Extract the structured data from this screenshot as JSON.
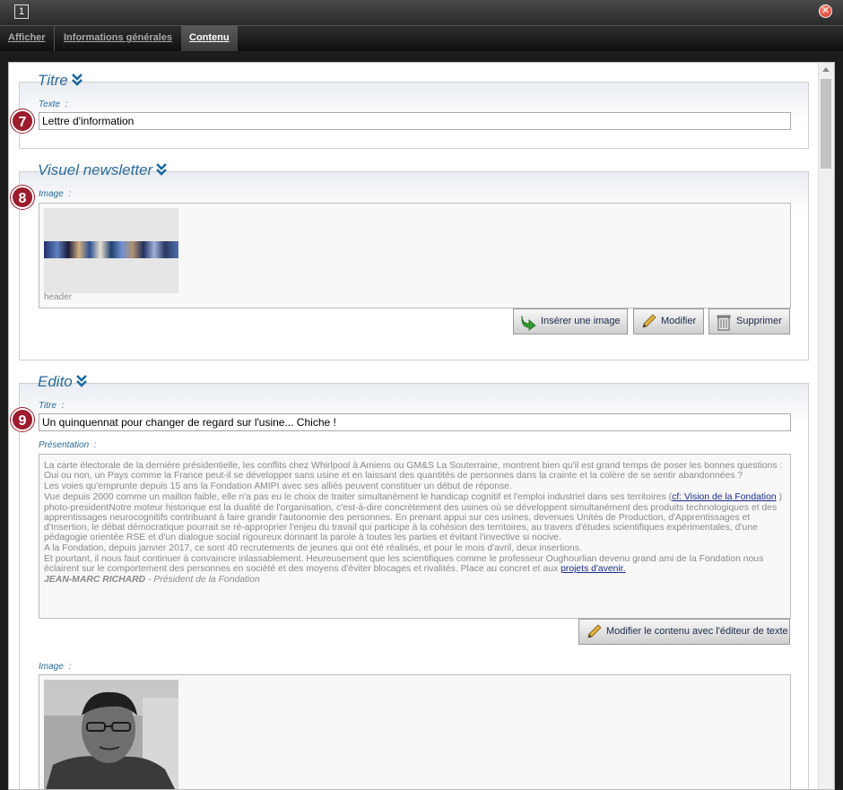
{
  "window": {
    "number": "1",
    "close_glyph": "✕"
  },
  "tabs": [
    {
      "label": "Afficher"
    },
    {
      "label": "Informations générales"
    },
    {
      "label": "Contenu",
      "active": true
    }
  ],
  "sections": {
    "titre": {
      "legend": "Titre",
      "badge": "7",
      "label": "Texte",
      "value": "Lettre d'information"
    },
    "visuel": {
      "legend": "Visuel newsletter",
      "badge": "8",
      "label": "Image",
      "caption": "header",
      "buttons": {
        "insert": "Insérer une image",
        "edit": "Modifier",
        "delete": "Supprimer"
      }
    },
    "edito": {
      "legend": "Edito",
      "badge": "9",
      "title_label": "Titre",
      "title_value": "Un quinquennat pour changer de regard sur l'usine... Chiche !",
      "presentation_label": "Présentation",
      "presentation": {
        "p1": "La carte électorale de la dernière présidentielle, les conflits chez Whirlpool à Amiens ou GM&S La Souterraine, montrent bien qu'il est grand temps de poser les bonnes questions : Oui ou non, un Pays comme la France peut-il se développer sans usine et en laissant des quantités de personnes dans la crainte et la colère de se sentir abandonnées ?",
        "p2": "Les voies qu'emprunte depuis 15 ans la Fondation AMIPI avec ses alliés peuvent constituer un début de réponse.",
        "p3_before": "Vue depuis 2000 comme un maillon faible, elle n'a pas eu le choix de traiter simultanément le handicap cognitif et  l'emploi industriel dans ses territoires (",
        "p3_link": "cf: Vision de la Fondation",
        "p3_after": " )",
        "p4": "photo-presidentNotre moteur historique est la dualité de l'organisation, c'est-à-dire concrètement des usines où se développent simultanément des produits technologiques et des apprentissages neurocognitifs contribuant à faire grandir l'autonomie des personnes. En prenant appui sur ces usines, devenues Unités de Production, d'Apprentissages et d'Insertion, le débat démocratique pourrait se ré-approprier l'enjeu du travail qui participe à la cohésion des territoires, au travers d'études scientifiques expérimentales, d'une pédagogie orientée RSE et d'un dialogue social rigoureux donnant la parole à toutes les parties et évitant l'invective si nocive.",
        "p5": "A la Fondation, depuis janvier 2017, ce sont 40 recrutements de jeunes qui ont été réalisés, et pour le mois d'avril, deux insertions.",
        "p6_before": "Et pourtant, il nous faut continuer à convaincre inlassablement. Heureusement que les scientifiques comme le professeur Oughourlian devenu grand ami de la Fondation nous éclairent sur le comportement des personnes en société et des moyens d'éviter blocages et rivalités. Place au concret et aux ",
        "p6_link": "projets d'avenir.",
        "sig_name": "JEAN-MARC RICHARD",
        "sig_role": " - Président de la Fondation"
      },
      "edit_button": "Modifier le contenu avec l'éditeur de texte",
      "image_label": "Image"
    }
  },
  "colors": {
    "accent": "#2b6a9a",
    "badge": "#9c1b2c"
  }
}
